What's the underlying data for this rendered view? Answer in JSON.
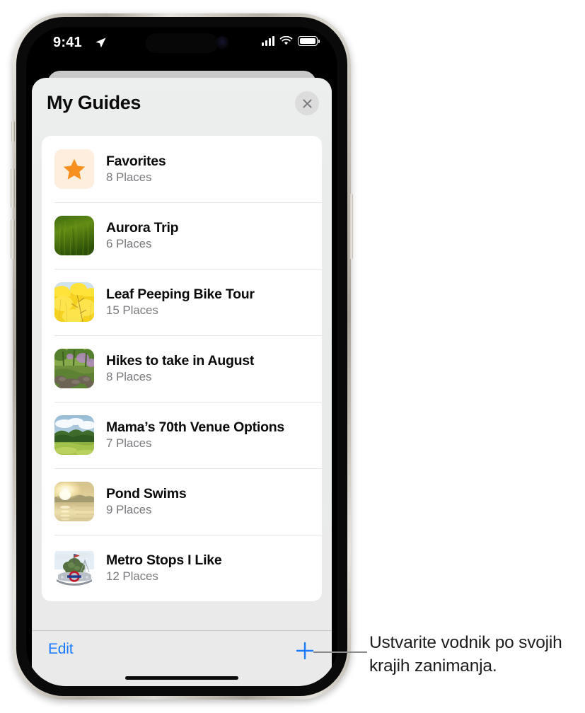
{
  "status_bar": {
    "time": "9:41",
    "location_icon": "location-arrow-icon",
    "cellular_icon": "cellular-signal-icon",
    "wifi_icon": "wifi-icon",
    "battery_icon": "battery-full-icon"
  },
  "sheet": {
    "title": "My Guides",
    "close_icon": "close-x-icon"
  },
  "guides": [
    {
      "name": "Favorites",
      "count": "8 Places",
      "thumb": "star-favorites-icon"
    },
    {
      "name": "Aurora Trip",
      "count": "6 Places",
      "thumb": "green-field-photo"
    },
    {
      "name": "Leaf Peeping Bike Tour",
      "count": "15 Places",
      "thumb": "yellow-autumn-leaves-photo"
    },
    {
      "name": "Hikes to take in August",
      "count": "8 Places",
      "thumb": "forest-trail-photo"
    },
    {
      "name": "Mama’s 70th Venue Options",
      "count": "7 Places",
      "thumb": "meadow-sky-photo"
    },
    {
      "name": "Pond Swims",
      "count": "9 Places",
      "thumb": "sunset-pond-photo"
    },
    {
      "name": "Metro Stops I Like",
      "count": "12 Places",
      "thumb": "london-underground-illustration"
    }
  ],
  "toolbar": {
    "edit_label": "Edit",
    "add_icon": "plus-icon"
  },
  "callout": {
    "text": "Ustvarite vodnik po svojih krajih zanimanja."
  },
  "colors": {
    "accent_blue": "#1a7aff",
    "favorites_star": "#f7901e",
    "favorites_bg": "#fdeedd",
    "sheet_bg": "#eaecec",
    "card_bg": "#ffffff",
    "secondary_text": "#7b7b7f"
  }
}
